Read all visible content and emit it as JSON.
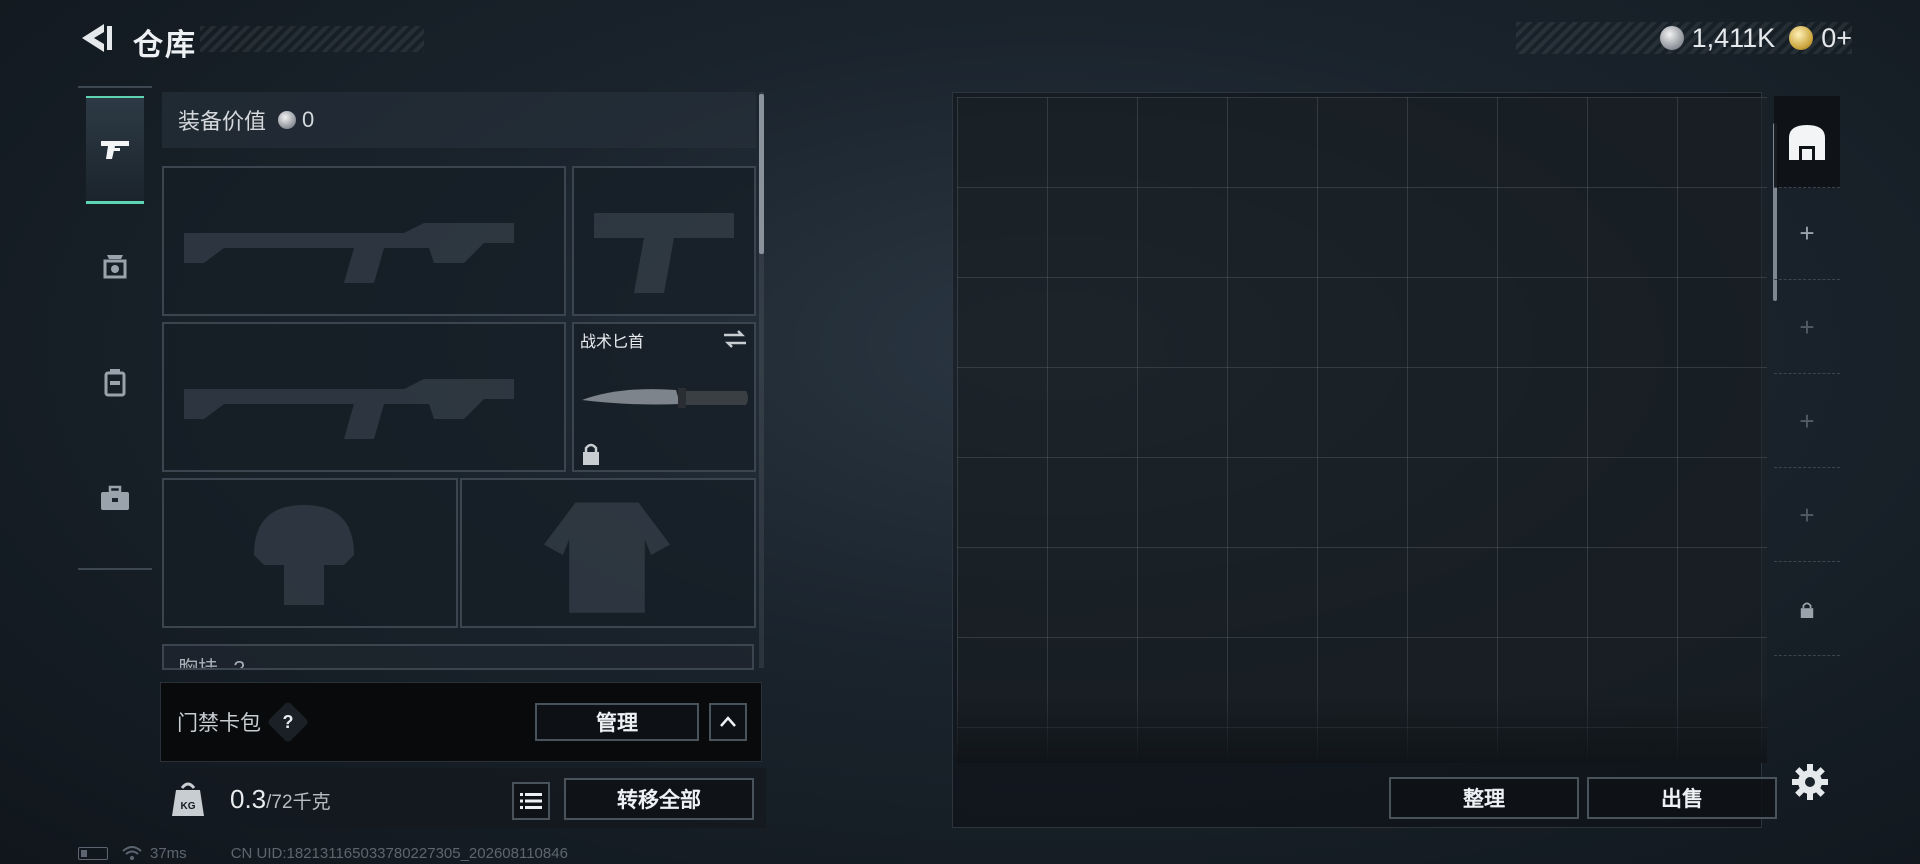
{
  "header": {
    "title": "仓库",
    "currency_silver": "1,411K",
    "currency_gold": "0+"
  },
  "tabs": [
    {
      "name": "weapons",
      "icon": "pistol-icon",
      "active": true
    },
    {
      "name": "armor",
      "icon": "helmet-armor-icon",
      "active": false
    },
    {
      "name": "backpack",
      "icon": "backpack-icon",
      "active": false
    },
    {
      "name": "case",
      "icon": "toolbox-icon",
      "active": false
    }
  ],
  "loadout": {
    "equip_value_label": "装备价值",
    "equip_value": "0",
    "knife_label": "战术匕首",
    "chest_rig_label": "胸挂",
    "chest_rig_extra": "?",
    "keycard_label": "门禁卡包",
    "help_badge": "?",
    "manage_button": "管理",
    "weight_current": "0.3",
    "weight_max": "/72千克",
    "transfer_all_button": "转移全部"
  },
  "storage": {
    "sort_button": "整理",
    "sell_button": "出售"
  },
  "status_bar": {
    "ping": "37ms",
    "uid": "CN UID:18213116503378022730​5_202608110846"
  },
  "colors": {
    "accent": "#5fd4b2",
    "panel_border": "#3a4550",
    "button_border": "#49535c"
  }
}
